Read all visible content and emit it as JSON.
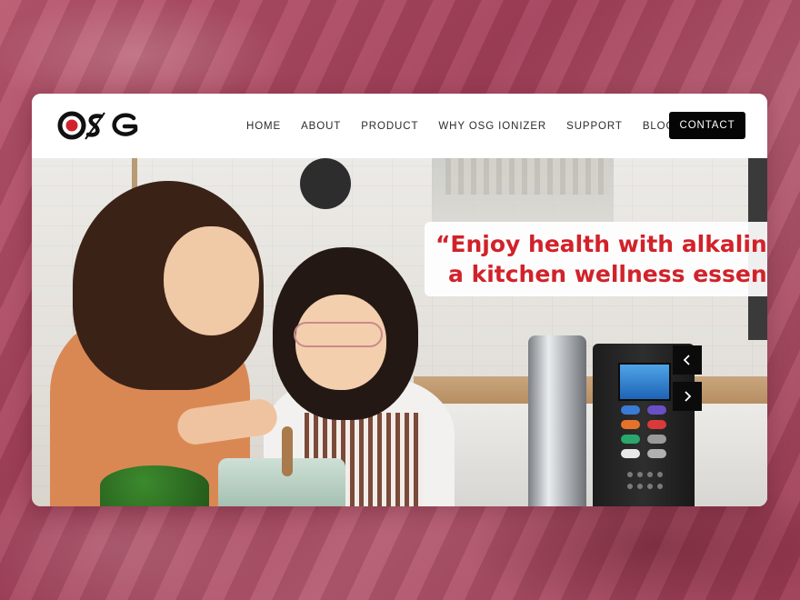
{
  "brand": {
    "logo_text": "OSG"
  },
  "nav": {
    "items": [
      {
        "label": "HOME"
      },
      {
        "label": "ABOUT"
      },
      {
        "label": "PRODUCT"
      },
      {
        "label": "WHY OSG IONIZER"
      },
      {
        "label": "SUPPORT"
      },
      {
        "label": "BLOGS"
      }
    ],
    "contact_label": "CONTACT"
  },
  "hero": {
    "headline_line1": "“Enjoy health with alkaline w",
    "headline_line2": "a kitchen wellness essentia",
    "prev_icon": "chevron-left-icon",
    "next_icon": "chevron-right-icon"
  },
  "colors": {
    "accent_red": "#d1222a",
    "background_fabric": "#a9465f",
    "contact_bg": "#050505"
  }
}
